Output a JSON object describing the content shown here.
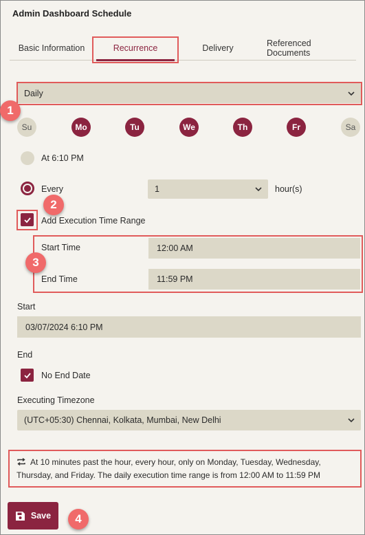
{
  "header": {
    "title": "Admin Dashboard Schedule"
  },
  "tabs": [
    {
      "label": "Basic Information"
    },
    {
      "label": "Recurrence"
    },
    {
      "label": "Delivery"
    },
    {
      "label": "Referenced Documents"
    }
  ],
  "frequency": {
    "value": "Daily"
  },
  "days": [
    {
      "label": "Su",
      "selected": false
    },
    {
      "label": "Mo",
      "selected": true
    },
    {
      "label": "Tu",
      "selected": true
    },
    {
      "label": "We",
      "selected": true
    },
    {
      "label": "Th",
      "selected": true
    },
    {
      "label": "Fr",
      "selected": true
    },
    {
      "label": "Sa",
      "selected": false
    }
  ],
  "at_option": {
    "label": "At 6:10 PM",
    "selected": false
  },
  "every_option": {
    "label": "Every",
    "selected": true,
    "interval": "1",
    "unit": "hour(s)"
  },
  "time_range": {
    "checkbox_label": "Add Execution Time Range",
    "checked": true,
    "start_label": "Start Time",
    "start_value": "12:00 AM",
    "end_label": "End Time",
    "end_value": "11:59 PM"
  },
  "start": {
    "label": "Start",
    "value": "03/07/2024 6:10 PM"
  },
  "end": {
    "label": "End",
    "no_end_label": "No End Date",
    "checked": true
  },
  "timezone": {
    "label": "Executing Timezone",
    "value": "(UTC+05:30) Chennai, Kolkata, Mumbai, New Delhi"
  },
  "summary": {
    "icon": "repeat-icon",
    "text": "At 10 minutes past the hour, every hour, only on Monday, Tuesday, Wednesday, Thursday, and Friday. The daily execution time range is from 12:00 AM to 11:59 PM"
  },
  "save": {
    "label": "Save",
    "icon": "save-icon"
  },
  "annotations": [
    "1",
    "2",
    "3",
    "4"
  ],
  "colors": {
    "accent": "#8b2440",
    "highlight": "#e05a5a",
    "field_bg": "#dcd8c8",
    "page_bg": "#f5f3ee"
  }
}
